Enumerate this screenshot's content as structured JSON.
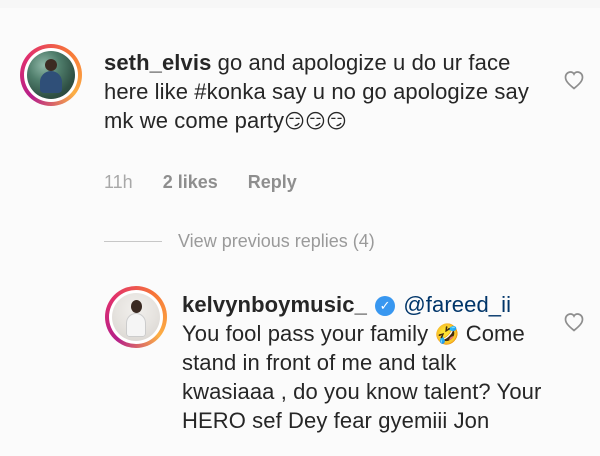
{
  "comments": [
    {
      "username": "seth_elvis",
      "text": " go and apologize u do ur face here like #konka say u no go apologize say mk we come party",
      "emojis": "😏😏😏",
      "time": "11h",
      "likes": "2 likes",
      "reply": "Reply"
    },
    {
      "username": "kelvynboymusic_",
      "mention": "@fareed_ii",
      "text_line1": "You fool pass your family",
      "emoji": "🤣",
      "text_rest": " Come stand in front of me and talk kwasiaaa , do you know talent? Your HERO sef Dey fear gyemiii Jon"
    }
  ],
  "replies": {
    "view_previous": "View previous replies (4)"
  },
  "icons": {
    "like": "heart-icon",
    "verified": "verified-badge-icon"
  },
  "colors": {
    "avatar_ring_start": "#b51f8a",
    "avatar_ring_end": "#fcaf45",
    "verified": "#3897f0",
    "mention": "#003569",
    "meta": "#8e8e8e"
  }
}
